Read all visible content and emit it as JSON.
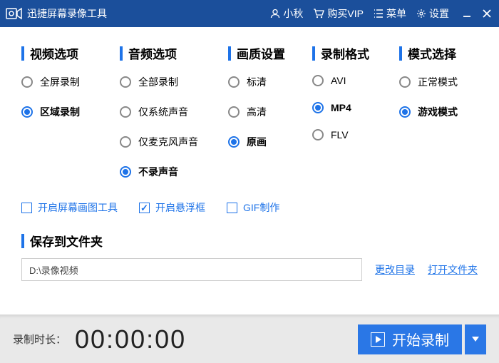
{
  "title": "迅捷屏幕录像工具",
  "titlebar": {
    "user": "小秋",
    "vip": "购买VIP",
    "menu": "菜单",
    "settings": "设置"
  },
  "columns": {
    "video": {
      "head": "视频选项",
      "opts": [
        "全屏录制",
        "区域录制"
      ],
      "selected": 1
    },
    "audio": {
      "head": "音频选项",
      "opts": [
        "全部录制",
        "仅系统声音",
        "仅麦克风声音",
        "不录声音"
      ],
      "selected": 3
    },
    "quality": {
      "head": "画质设置",
      "opts": [
        "标清",
        "高清",
        "原画"
      ],
      "selected": 2
    },
    "format": {
      "head": "录制格式",
      "opts": [
        "AVI",
        "MP4",
        "FLV"
      ],
      "selected": 1
    },
    "mode": {
      "head": "模式选择",
      "opts": [
        "正常模式",
        "游戏模式"
      ],
      "selected": 1
    }
  },
  "checks": {
    "drawTool": {
      "label": "开启屏幕画图工具",
      "checked": false
    },
    "float": {
      "label": "开启悬浮框",
      "checked": true
    },
    "gif": {
      "label": "GIF制作",
      "checked": false
    }
  },
  "save": {
    "head": "保存到文件夹",
    "path": "D:\\录像视频",
    "change": "更改目录",
    "open": "打开文件夹"
  },
  "bottom": {
    "label": "录制时长：",
    "time": "00:00:00",
    "start": "开始录制"
  }
}
